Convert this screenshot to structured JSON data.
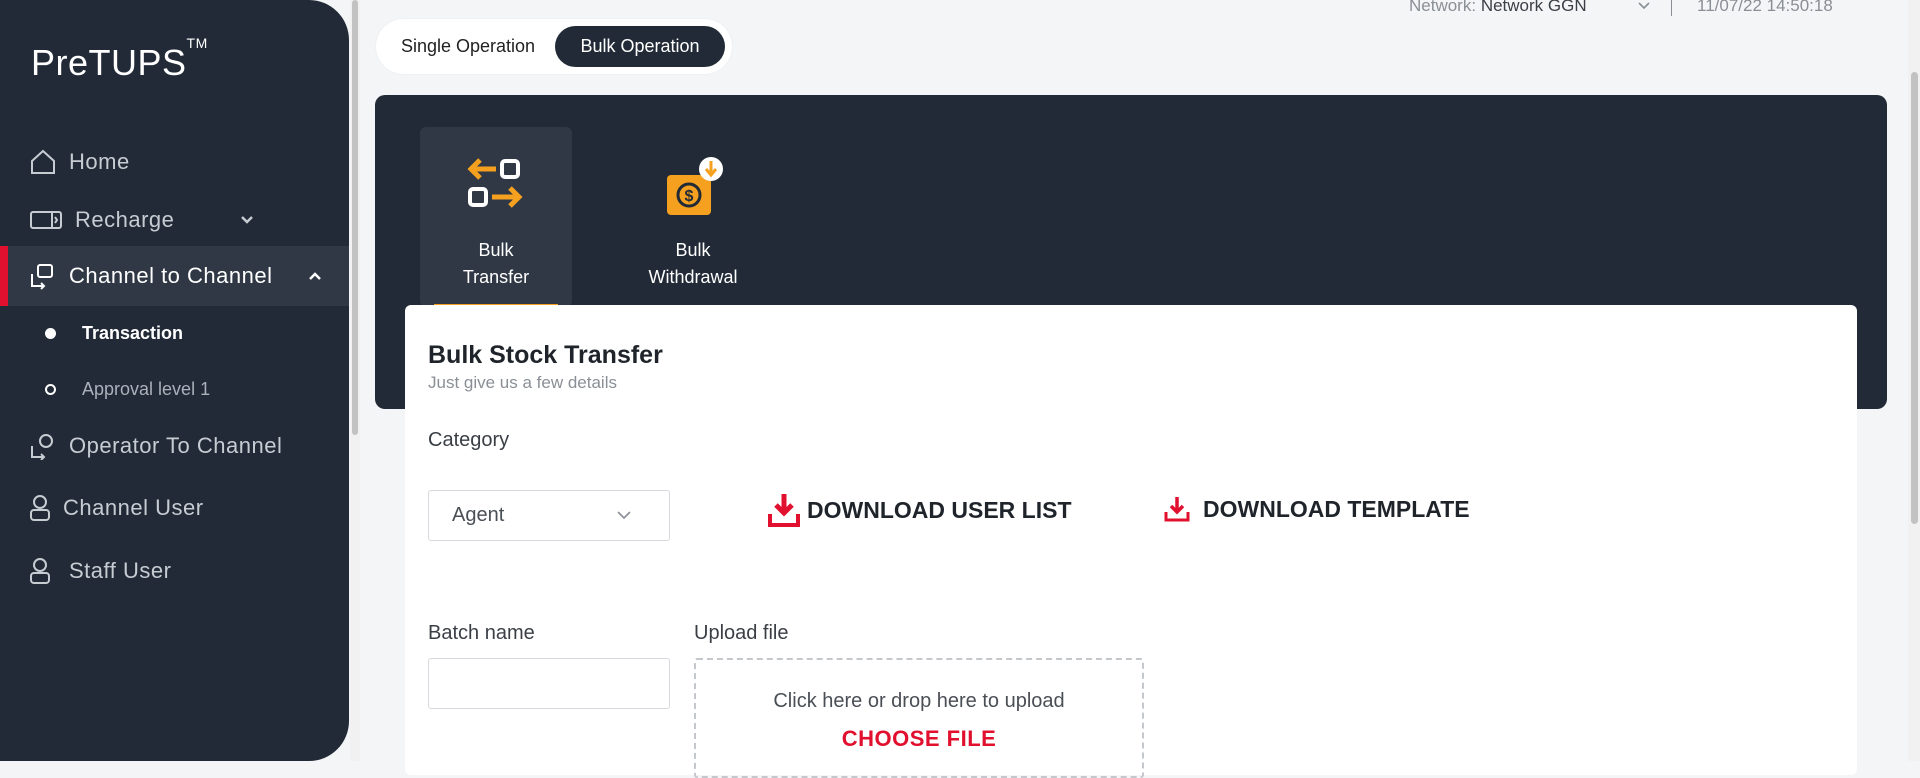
{
  "app": {
    "logo": "PreTUPS",
    "logo_tm": "TM"
  },
  "topbar": {
    "network_label": "Network:",
    "network_value": "Network GGN",
    "datetime": "11/07/22 14:50:18"
  },
  "sidebar": {
    "items": [
      {
        "label": "Home",
        "icon": "home-icon"
      },
      {
        "label": "Recharge",
        "icon": "recharge-icon"
      },
      {
        "label": "Channel to Channel",
        "icon": "channel-icon"
      },
      {
        "label": "Operator To Channel",
        "icon": "operator-icon"
      },
      {
        "label": "Channel User",
        "icon": "user-icon"
      },
      {
        "label": "Staff User",
        "icon": "user-icon"
      }
    ],
    "subitems": [
      {
        "label": "Transaction"
      },
      {
        "label": "Approval level 1"
      }
    ]
  },
  "toggle": {
    "single": "Single Operation",
    "bulk": "Bulk Operation"
  },
  "tiles": [
    {
      "line1": "Bulk",
      "line2": "Transfer",
      "icon": "transfer-arrows-icon"
    },
    {
      "line1": "Bulk",
      "line2": "Withdrawal",
      "icon": "withdrawal-icon"
    }
  ],
  "form": {
    "title": "Bulk Stock Transfer",
    "subtitle": "Just give us a few details",
    "category_label": "Category",
    "category_value": "Agent",
    "download_user_list": "DOWNLOAD USER LIST",
    "download_template": "DOWNLOAD TEMPLATE",
    "batch_label": "Batch name",
    "batch_value": "",
    "upload_label": "Upload file",
    "upload_hint": "Click here or drop here to upload",
    "choose_file": "CHOOSE FILE"
  },
  "colors": {
    "sidebar": "#212a36",
    "accent": "#e0102e",
    "orange": "#f5a01f"
  }
}
